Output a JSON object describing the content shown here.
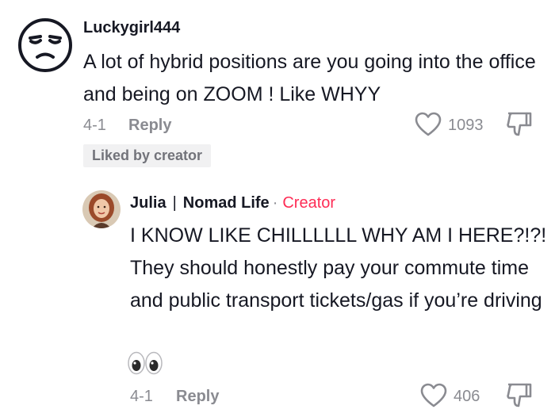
{
  "comment": {
    "username": "Luckygirl444",
    "text": "A lot of hybrid positions are you going into the office and being on ZOOM ! Like WHYY",
    "date": "4-1",
    "reply_label": "Reply",
    "like_count": "1093",
    "liked_by_creator": "Liked by creator",
    "avatar_icon": "unamused-face-emoji-icon"
  },
  "reply": {
    "display_name": "Julia",
    "separator": "|",
    "channel_name": "Nomad Life",
    "dot": "·",
    "creator_badge": "Creator",
    "text": "I KNOW LIKE CHILLLLLL WHY AM I HERE?!?! They should honestly pay your commute time and public transport tickets/gas if you’re driving",
    "emoji": "eyes-emoji-icon",
    "date": "4-1",
    "reply_label": "Reply",
    "like_count": "406",
    "creator_color": "#fe2c55"
  }
}
